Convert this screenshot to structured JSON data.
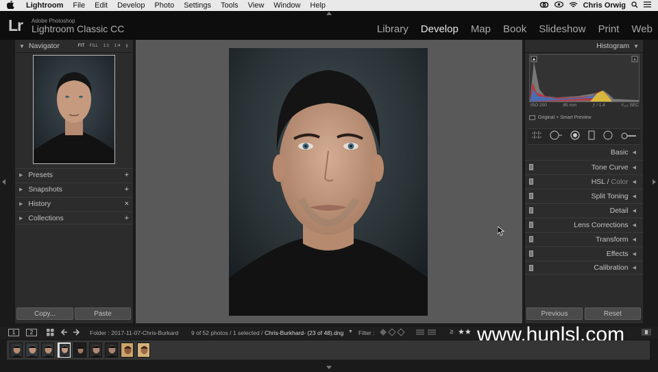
{
  "menubar": {
    "app": "Lightroom",
    "items": [
      "File",
      "Edit",
      "Develop",
      "Photo",
      "Settings",
      "Tools",
      "View",
      "Window",
      "Help"
    ],
    "user": "Chris Orwig"
  },
  "identity": {
    "logo": "Lr",
    "brand_small": "Adobe Photoshop",
    "brand_big": "Lightroom Classic CC"
  },
  "modules": {
    "items": [
      "Library",
      "Develop",
      "Map",
      "Book",
      "Slideshow",
      "Print",
      "Web"
    ],
    "active": "Develop"
  },
  "left_panel": {
    "navigator": {
      "title": "Navigator",
      "zoom": [
        "FIT",
        "FILL",
        "1:1",
        "1:4"
      ]
    },
    "sections": [
      {
        "label": "Presets",
        "action": "+"
      },
      {
        "label": "Snapshots",
        "action": "+"
      },
      {
        "label": "History",
        "action": "×"
      },
      {
        "label": "Collections",
        "action": "+"
      }
    ],
    "copy_label": "Copy...",
    "paste_label": "Paste"
  },
  "right_panel": {
    "histogram_title": "Histogram",
    "info": {
      "iso": "ISO 200",
      "focal": "85 mm",
      "aperture": "ƒ / 1.4",
      "shutter": "¹⁄₁₂₅ SEC"
    },
    "preview_label": "Original + Smart Preview",
    "sections": [
      {
        "label": "Basic"
      },
      {
        "label": "Tone Curve"
      },
      {
        "label": "HSL",
        "label2": "Color"
      },
      {
        "label": "Split Toning"
      },
      {
        "label": "Detail"
      },
      {
        "label": "Lens Corrections"
      },
      {
        "label": "Transform"
      },
      {
        "label": "Effects"
      },
      {
        "label": "Calibration"
      }
    ],
    "previous_label": "Previous",
    "reset_label": "Reset"
  },
  "filmstrip_bar": {
    "page1": "1",
    "page2": "2",
    "folder": "Folder : 2017-11-07-Chris-Burkard",
    "count": "9 of 52 photos / 1 selected /",
    "filename": "Chris-Burkhard- (23 of 48).dng",
    "filter_label": "Filter :",
    "rating_op": "≥",
    "stars": "★★"
  },
  "watermark": "www.hunlsl.com",
  "filmstrip": {
    "thumb_count": 9,
    "selected_index": 3
  }
}
